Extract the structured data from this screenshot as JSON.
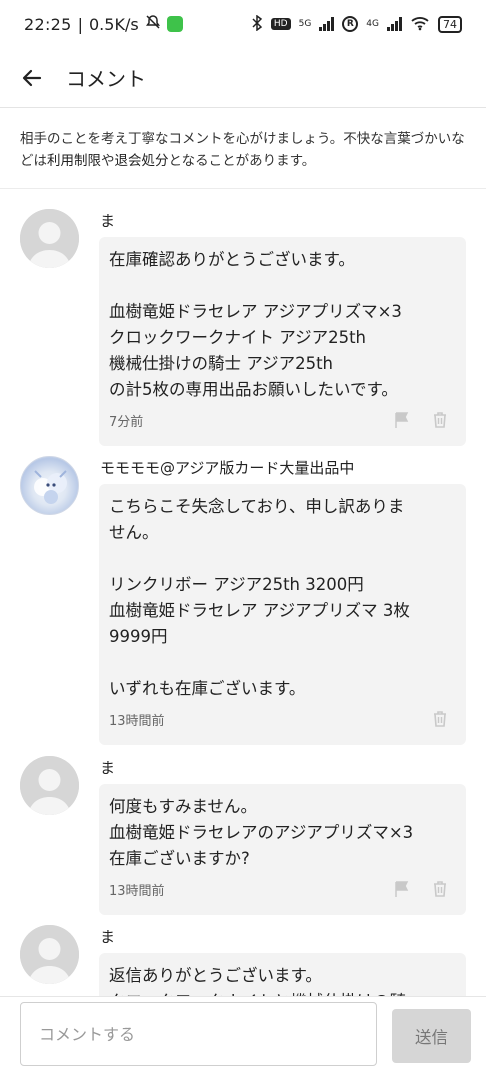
{
  "status_bar": {
    "time": "22:25",
    "speed": "0.5K/s",
    "net1": "5G",
    "net2": "4G",
    "roaming": "R",
    "battery": "74",
    "hd": "HD"
  },
  "header": {
    "title": "コメント"
  },
  "notice": {
    "text_pre": "相手のことを考え丁寧なコメントを心がけましょう。不快な言葉づかいなどは",
    "emph1": "利用制限",
    "mid": "や",
    "emph2": "退会処分",
    "text_post": "となることがあります。"
  },
  "comments": [
    {
      "name": "ま",
      "text": "在庫確認ありがとうございます。\n\n血樹竜姫ドラセレア アジアプリズマ×3\nクロックワークナイト アジア25th\n機械仕掛けの騎士 アジア25th\nの計5枚の専用出品お願いしたいです。",
      "time": "7分前"
    },
    {
      "name": "モモモモ@アジア版カード大量出品中",
      "text": "こちらこそ失念しており、申し訳ありま\nせん。\n\nリンクリボー アジア25th 3200円\n血樹竜姫ドラセレア アジアプリズマ 3枚\n9999円\n\nいずれも在庫ございます。",
      "time": "13時間前"
    },
    {
      "name": "ま",
      "text": "何度もすみません。\n血樹竜姫ドラセレアのアジアプリズマ×3\n在庫ございますか?",
      "time": "13時間前"
    },
    {
      "name": "ま",
      "text": "返信ありがとうございます。\nクロックワークナイトと機械仕掛けの騎",
      "time": ""
    }
  ],
  "input": {
    "placeholder": "コメントする",
    "send_label": "送信"
  },
  "icons": {
    "back": "arrow-left-icon",
    "report": "flag-icon",
    "delete": "trash-icon"
  }
}
